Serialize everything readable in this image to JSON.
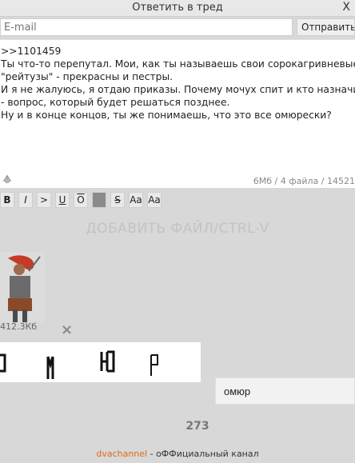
{
  "window": {
    "title": "Ответить в тред",
    "close_label": "X"
  },
  "form": {
    "email_placeholder": "E-mail",
    "send_label": "Отправить",
    "message_lines": [
      ">>1101459",
      "Ты что-то перепутал. Мои, как ты называешь свои сорокагривневые",
      "\"рейтузы\" - прекрасны и пестры.",
      "И я не жалуюсь, я отдаю приказы. Почему мочух спит и кто назначил",
      "- вопрос, который будет решаться позднее.",
      "",
      "Ну и в конце концов, ты же понимаешь, что это все омюрески?"
    ],
    "meta": "6Мб / 4 файла / 14521"
  },
  "toolbar": {
    "buttons": [
      "B",
      "I",
      ">",
      "U",
      "O",
      "",
      "S",
      "Aa",
      "Aa"
    ]
  },
  "files": {
    "add_label": "ДОБАВИТЬ ФАЙЛ/CTRL-V",
    "thumb_size": "412.3Кб",
    "remove_label": "×"
  },
  "captcha": {
    "input_value": "омюр",
    "counter": "273"
  },
  "footer": {
    "brand": "dvachannel",
    "rest": " - оФФициальный канал"
  }
}
